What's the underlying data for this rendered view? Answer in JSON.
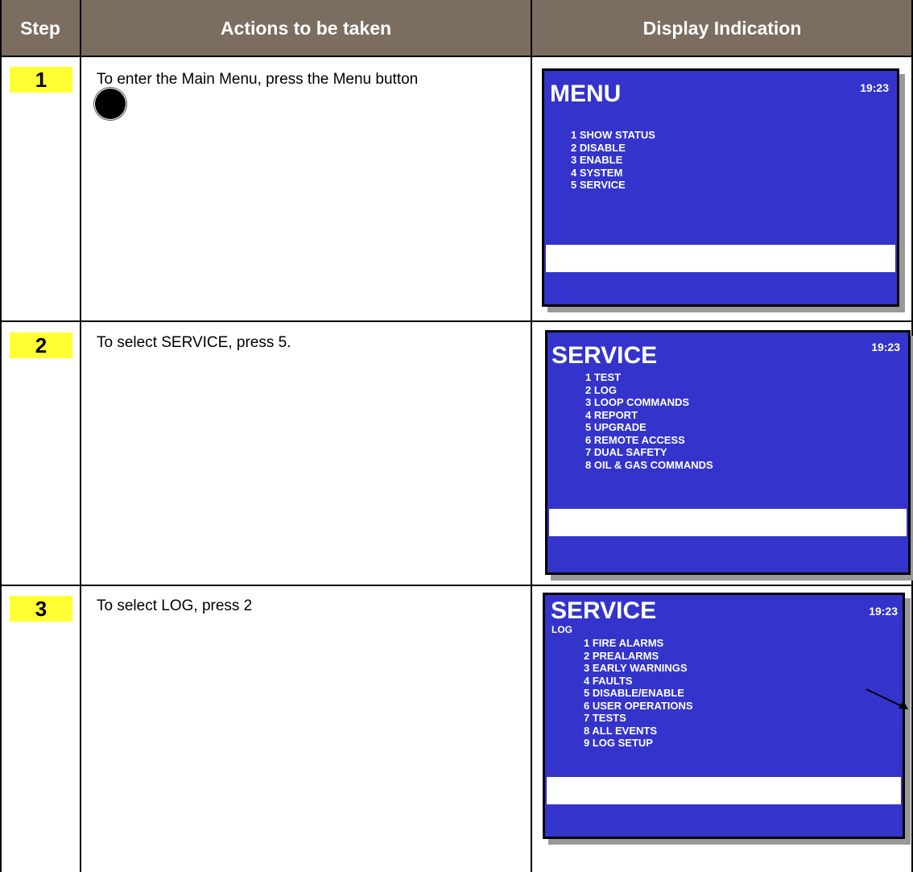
{
  "header": {
    "step": "Step",
    "action": "Actions to be taken",
    "display": "Display Indication"
  },
  "colors": {
    "header_bg": "#7b6e60",
    "step_badge": "#ffff33",
    "screen_bg": "#3434cc"
  },
  "rows": [
    {
      "step": "1",
      "action": "To enter the Main Menu, press the Menu button",
      "action_icon": "filled-circle-icon",
      "screen": {
        "title": "MENU",
        "time": "19:23",
        "items": [
          "1 SHOW STATUS",
          "2 DISABLE",
          "3 ENABLE",
          "4 SYSTEM",
          "5 SERVICE"
        ]
      }
    },
    {
      "step": "2",
      "action": "To select SERVICE, press 5.",
      "screen": {
        "title": "SERVICE",
        "time": "19:23",
        "items": [
          "1 TEST",
          "2 LOG",
          "3 LOOP COMMANDS",
          "4 REPORT",
          "5 UPGRADE",
          "6 REMOTE ACCESS",
          "7 DUAL SAFETY",
          "8 OIL & GAS COMMANDS"
        ]
      }
    },
    {
      "step": "3",
      "action": "To select LOG, press 2",
      "screen": {
        "title": "SERVICE",
        "subtitle": "LOG",
        "time": "19:23",
        "items": [
          "1 FIRE  ALARMS",
          "2 PREALARMS",
          "3 EARLY WARNINGS",
          "4 FAULTS",
          "5 DISABLE/ENABLE",
          "6 USER OPERATIONS",
          "7 TESTS",
          "8 ALL EVENTS",
          "9 LOG SETUP"
        ]
      }
    }
  ],
  "continuation_icon": "arrow-down-right-icon"
}
